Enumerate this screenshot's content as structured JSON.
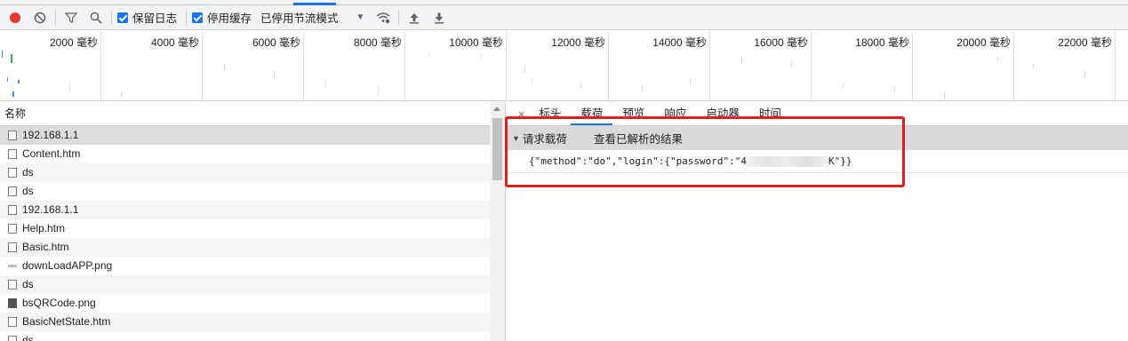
{
  "toolbar": {
    "preserve_log_label": "保留日志",
    "disable_cache_label": "停用缓存",
    "throttling_value": "已停用节流模式",
    "colors": {
      "record": "#e8392e",
      "checkbox": "#1a73e8"
    },
    "icons": [
      "record-icon",
      "clear-icon",
      "filter-icon",
      "search-icon",
      "dropdown-icon",
      "network-conditions-icon",
      "upload-icon",
      "download-icon"
    ]
  },
  "timeline": {
    "ticks": [
      "2000 毫秒",
      "4000 毫秒",
      "6000 毫秒",
      "8000 毫秒",
      "10000 毫秒",
      "12000 毫秒",
      "14000 毫秒",
      "16000 毫秒",
      "18000 毫秒",
      "20000 毫秒",
      "22000 毫秒"
    ]
  },
  "requests": {
    "column_name": "名称",
    "rows": [
      {
        "name": "192.168.1.1",
        "icon": "doc"
      },
      {
        "name": "Content.htm",
        "icon": "doc"
      },
      {
        "name": "ds",
        "icon": "doc"
      },
      {
        "name": "ds",
        "icon": "doc"
      },
      {
        "name": "192.168.1.1",
        "icon": "doc"
      },
      {
        "name": "Help.htm",
        "icon": "doc"
      },
      {
        "name": "Basic.htm",
        "icon": "doc"
      },
      {
        "name": "downLoadAPP.png",
        "icon": "image"
      },
      {
        "name": "ds",
        "icon": "doc"
      },
      {
        "name": "bsQRCode.png",
        "icon": "qr-image"
      },
      {
        "name": "BasicNetState.htm",
        "icon": "doc"
      },
      {
        "name": "ds",
        "icon": "doc"
      }
    ]
  },
  "detail": {
    "close": "×",
    "tabs": [
      "标头",
      "载荷",
      "预览",
      "响应",
      "启动器",
      "时间"
    ],
    "active_tab": "载荷",
    "section_title": "请求载荷",
    "section_link": "查看已解析的结果",
    "payload_prefix": "{\"method\":\"do\",\"login\":{\"password\":\"4",
    "payload_suffix": "K\"}}"
  }
}
